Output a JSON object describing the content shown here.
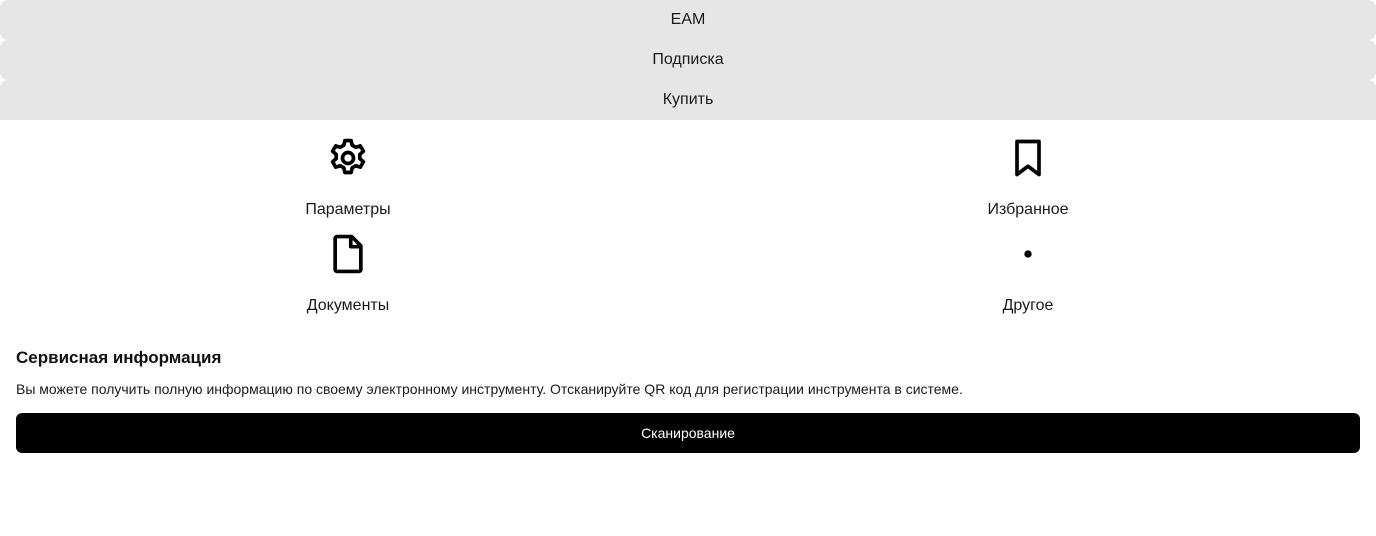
{
  "top_menu": {
    "items": [
      {
        "label": "EAM"
      },
      {
        "label": "Подписка"
      },
      {
        "label": "Купить"
      }
    ]
  },
  "tiles": {
    "params": {
      "label": "Параметры",
      "icon": "gear-icon"
    },
    "favorites": {
      "label": "Избранное",
      "icon": "bookmark-icon"
    },
    "documents": {
      "label": "Документы",
      "icon": "document-icon"
    },
    "other": {
      "label": "Другое",
      "icon": "dot-icon"
    }
  },
  "service": {
    "title": "Сервисная информация",
    "description": "Вы можете получить полную информацию по своему электронному инструменту. Отсканируйте QR код для регистрации инструмента в системе.",
    "scan_button_label": "Сканирование"
  },
  "colors": {
    "menu_background": "#e6e6e6",
    "button_background": "#000000",
    "button_text": "#ffffff"
  }
}
